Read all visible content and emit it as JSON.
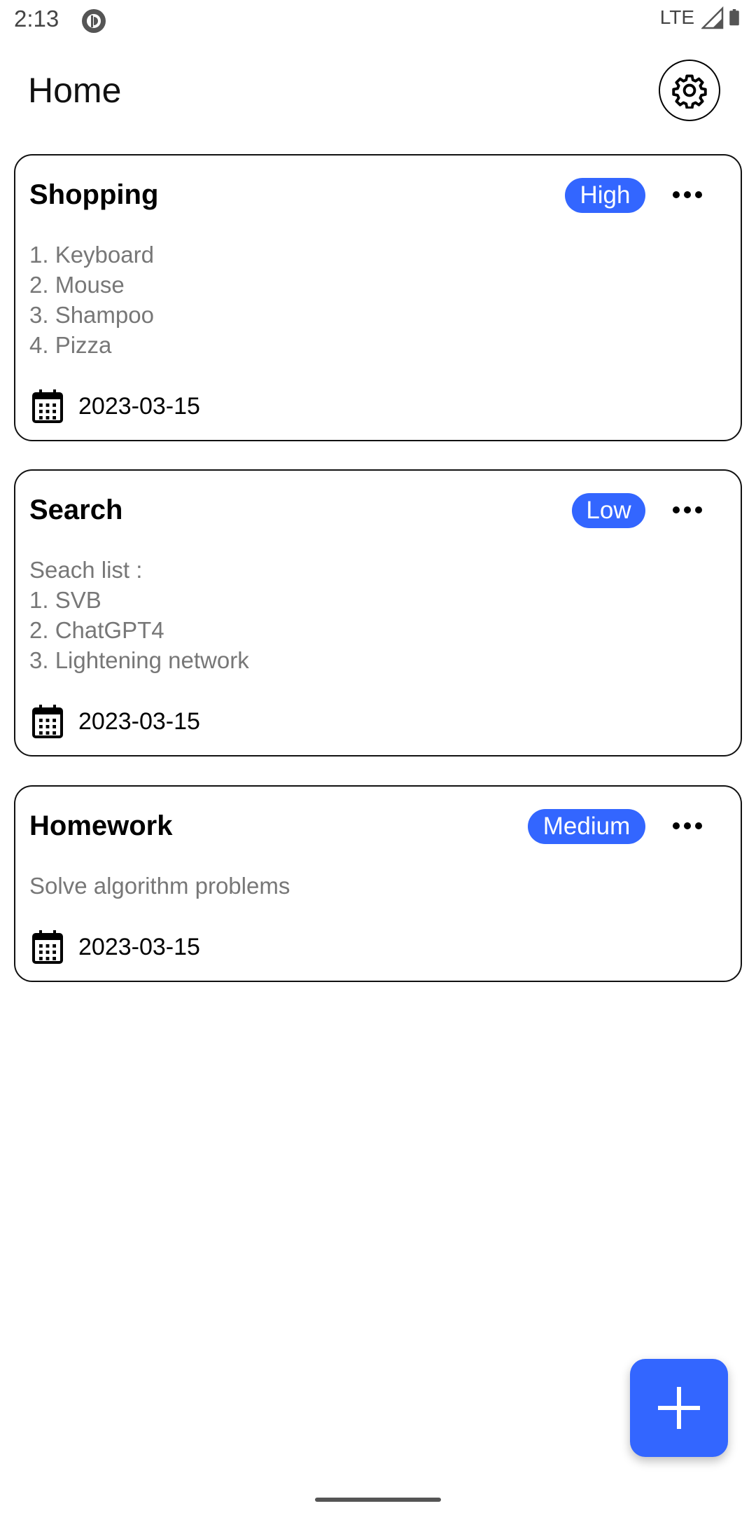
{
  "status_bar": {
    "time": "2:13",
    "network": "LTE",
    "app_icon": "pocket-casts-icon",
    "signal_icon": "signal-icon",
    "battery_icon": "battery-icon"
  },
  "header": {
    "title": "Home",
    "settings_icon": "gear-icon"
  },
  "accent_color": "#3366ff",
  "tasks": [
    {
      "title": "Shopping",
      "priority": "High",
      "lines": [
        "1. Keyboard",
        "2. Mouse",
        "3. Shampoo",
        "4. Pizza"
      ],
      "date": "2023-03-15"
    },
    {
      "title": "Search",
      "priority": "Low",
      "lines": [
        "Seach list :",
        "1. SVB",
        "2. ChatGPT4",
        "3. Lightening network"
      ],
      "date": "2023-03-15"
    },
    {
      "title": "Homework",
      "priority": "Medium",
      "lines": [
        "Solve algorithm problems"
      ],
      "date": "2023-03-15"
    }
  ],
  "fab": {
    "icon": "plus-icon"
  }
}
